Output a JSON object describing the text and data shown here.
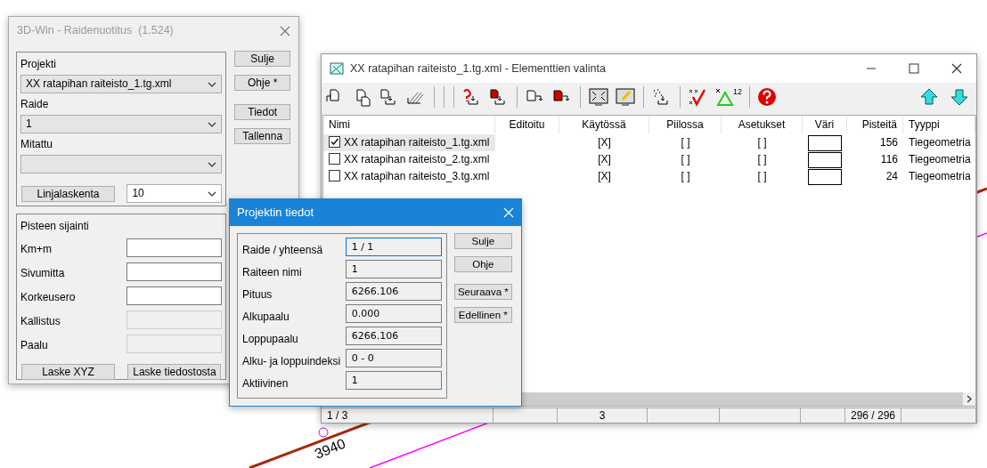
{
  "canvas": {
    "labels": [
      "3940"
    ]
  },
  "raidenuotitus": {
    "title": "3D-Win - Raidenuotitus  (1.524)",
    "project_group": {
      "fields": [
        {
          "label": "Projekti",
          "value": "XX ratapihan raiteisto_1.tg.xml"
        },
        {
          "label": "Raide",
          "value": "1"
        },
        {
          "label": "Mitattu"
        }
      ],
      "line_button": "Linjalaskenta",
      "step_value": "10"
    },
    "location_group": {
      "title": "Pisteen sijainti",
      "fields": [
        {
          "label": "Km+m",
          "disabled": false
        },
        {
          "label": "Sivumitta",
          "disabled": false
        },
        {
          "label": "Korkeusero",
          "disabled": false
        },
        {
          "label": "Kallistus",
          "disabled": true
        },
        {
          "label": "Paalu",
          "disabled": true
        }
      ],
      "buttons": [
        "Laske XYZ",
        "Laske tiedostosta"
      ]
    },
    "buttons": [
      "Sulje",
      "Ohje *",
      "Tiedot",
      "Tallenna"
    ]
  },
  "element_window": {
    "title": "XX ratapihan raiteisto_1.tg.xml - Elementtien valinta",
    "toolbar": {
      "count_icon_label": "12"
    },
    "columns": [
      "Nimi",
      "Editoitu",
      "Käytössä",
      "Piilossa",
      "Asetukset",
      "Väri",
      "Pisteitä",
      "Tyyppi"
    ],
    "rows": [
      {
        "name": "XX ratapihan raiteisto_1.tg.xml",
        "checked": true,
        "selected": true,
        "in_use": "[X]",
        "hidden": "[ ]",
        "settings": "[ ]",
        "color": "#ffffff",
        "points": "156",
        "type": "Tiegeometria"
      },
      {
        "name": "XX ratapihan raiteisto_2.tg.xml",
        "checked": false,
        "selected": false,
        "in_use": "[X]",
        "hidden": "[ ]",
        "settings": "[ ]",
        "color": "#ffffff",
        "points": "116",
        "type": "Tiegeometria"
      },
      {
        "name": "XX ratapihan raiteisto_3.tg.xml",
        "checked": false,
        "selected": false,
        "in_use": "[X]",
        "hidden": "[ ]",
        "settings": "[ ]",
        "color": "#ffffff",
        "points": "24",
        "type": "Tiegeometria"
      }
    ],
    "status_bar": {
      "column_1": "1 / 3",
      "column_3": "3",
      "column_7": "296 / 296"
    }
  },
  "project_info": {
    "title": "Projektin tiedot",
    "fields": [
      {
        "label": "Raide / yhteensä",
        "value": "1 / 1",
        "focused": true
      },
      {
        "label": "Raiteen nimi",
        "value": "1",
        "focused": false
      },
      {
        "label": "Pituus",
        "value": "6266.106",
        "focused": false
      },
      {
        "label": "Alkupaalu",
        "value": "0.000",
        "focused": false
      },
      {
        "label": "Loppupaalu",
        "value": "6266.106",
        "focused": false
      },
      {
        "label": "Alku- ja loppuindeksi",
        "value": "0 - 0",
        "focused": false
      },
      {
        "label": "Aktiivinen",
        "value": "1",
        "focused": false
      }
    ],
    "buttons": [
      "Sulje",
      "Ohje",
      "Seuraava *",
      "Edellinen *"
    ]
  }
}
